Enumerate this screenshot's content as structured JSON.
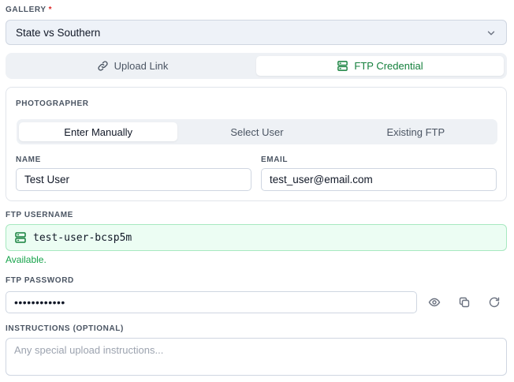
{
  "gallery": {
    "label": "GALLERY",
    "required_mark": "*",
    "selected": "State vs Southern"
  },
  "credential_tabs": [
    {
      "label": "Upload Link",
      "icon": "link-icon",
      "active": false
    },
    {
      "label": "FTP Credential",
      "icon": "server-icon",
      "active": true
    }
  ],
  "photographer": {
    "label": "PHOTOGRAPHER",
    "tabs": [
      {
        "label": "Enter Manually",
        "active": true
      },
      {
        "label": "Select User",
        "active": false
      },
      {
        "label": "Existing FTP",
        "active": false
      }
    ],
    "name_label": "NAME",
    "name_value": "Test User",
    "email_label": "EMAIL",
    "email_value": "test_user@email.com"
  },
  "ftp_username": {
    "label": "FTP USERNAME",
    "value": "test-user-bcsp5m",
    "status": "Available."
  },
  "ftp_password": {
    "label": "FTP PASSWORD",
    "masked_value": "••••••••••••"
  },
  "instructions": {
    "label": "INSTRUCTIONS (OPTIONAL)",
    "placeholder": "Any special upload instructions..."
  },
  "colors": {
    "accent": "#15803d",
    "success_bg": "#ecfdf3",
    "success_text": "#16a34a",
    "required": "#dc2626"
  }
}
